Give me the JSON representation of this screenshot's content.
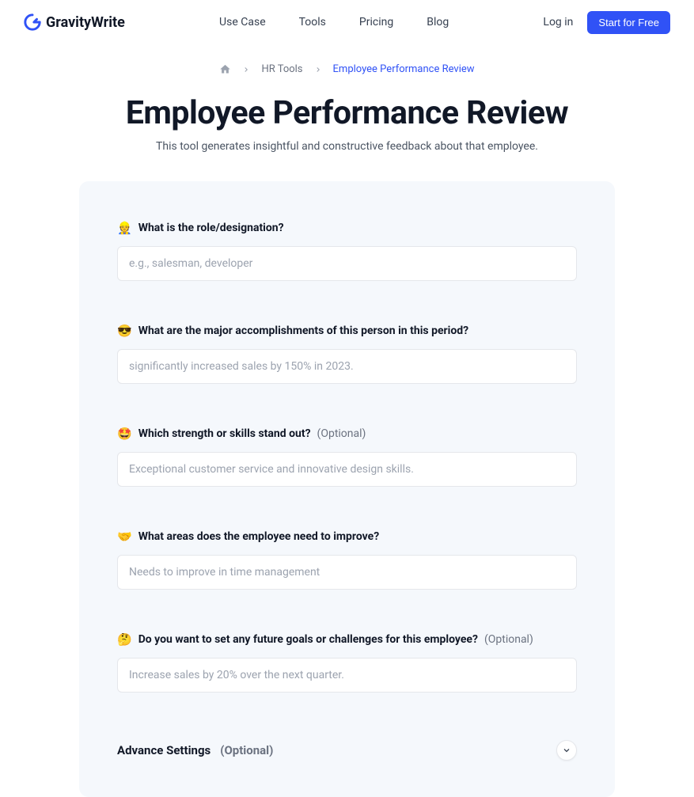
{
  "header": {
    "logo_text": "GravityWrite",
    "nav": [
      "Use Case",
      "Tools",
      "Pricing",
      "Blog"
    ],
    "login": "Log in",
    "start_free": "Start for Free"
  },
  "breadcrumb": {
    "level1": "HR Tools",
    "current": "Employee Performance Review"
  },
  "page": {
    "title": "Employee Performance Review",
    "subtitle": "This tool generates insightful and constructive feedback about that employee."
  },
  "form": {
    "fields": [
      {
        "emoji": "👷",
        "label": "What is the role/designation?",
        "optional": "",
        "placeholder": "e.g., salesman, developer"
      },
      {
        "emoji": "😎",
        "label": "What are the major accomplishments of this person in this period?",
        "optional": "",
        "placeholder": "significantly increased sales by 150% in 2023."
      },
      {
        "emoji": "🤩",
        "label": "Which strength or skills stand out?",
        "optional": "(Optional)",
        "placeholder": "Exceptional customer service and innovative design skills."
      },
      {
        "emoji": "🤝",
        "label": "What areas does the employee need to improve?",
        "optional": "",
        "placeholder": "Needs to improve in time management"
      },
      {
        "emoji": "🤔",
        "label": "Do you want to set any future goals or challenges for this employee?",
        "optional": "(Optional)",
        "placeholder": "Increase sales by 20% over the next quarter."
      }
    ],
    "advance": {
      "label": "Advance Settings",
      "optional": "(Optional)"
    }
  }
}
